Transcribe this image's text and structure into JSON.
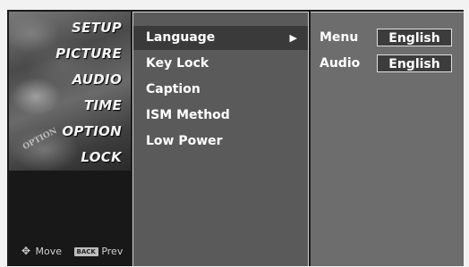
{
  "main_menu": {
    "items": [
      {
        "label": "SETUP"
      },
      {
        "label": "PICTURE"
      },
      {
        "label": "AUDIO"
      },
      {
        "label": "TIME"
      },
      {
        "label": "OPTION"
      },
      {
        "label": "LOCK"
      }
    ]
  },
  "footer": {
    "move_label": "Move",
    "back_key_label": "BACK",
    "prev_label": "Prev"
  },
  "submenu": {
    "items": [
      {
        "label": "Language",
        "arrow": "▶",
        "selected": true
      },
      {
        "label": "Key Lock"
      },
      {
        "label": "Caption"
      },
      {
        "label": "ISM Method"
      },
      {
        "label": "Low Power"
      }
    ]
  },
  "options": [
    {
      "label": "Menu",
      "value": "English"
    },
    {
      "label": "Audio",
      "value": "English"
    }
  ],
  "art_text": "OPTION",
  "colors": {
    "panel_dark": "#1b1b1b",
    "submenu_bg": "#5a5a5a",
    "selected_bg": "#3a3a3a",
    "value_bg": "#3c3c3c",
    "right_bg": "#6d6d6d"
  }
}
